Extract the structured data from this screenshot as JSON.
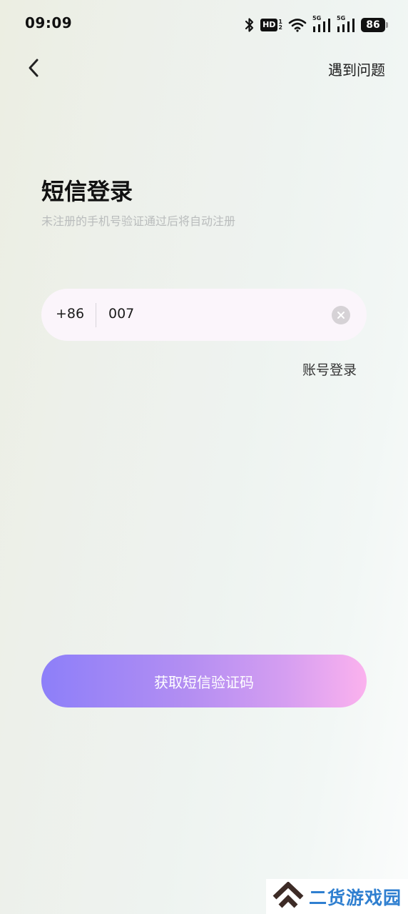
{
  "status_bar": {
    "time": "09:09",
    "hd_label": "HD",
    "network_label_1": "5G",
    "network_label_2": "5G",
    "battery_level": "86"
  },
  "header": {
    "help_label": "遇到问题"
  },
  "main": {
    "title": "短信登录",
    "subtitle": "未注册的手机号验证通过后将自动注册",
    "country_code": "+86",
    "phone_value": "007",
    "account_login_label": "账号登录",
    "submit_label": "获取短信验证码"
  },
  "watermark": {
    "text": "二货游戏园"
  },
  "colors": {
    "button_gradient_start": "#8d7ff9",
    "button_gradient_end": "#fbb2ee",
    "field_background": "#fbf5fb",
    "watermark_text": "#2f7fd0",
    "watermark_logo": "#3d2b26"
  },
  "icons": {
    "back": "chevron-left-icon",
    "clear": "close-circle-icon",
    "bluetooth": "bluetooth-icon",
    "wifi": "wifi-icon",
    "signal": "cellular-signal-icon",
    "battery": "battery-icon",
    "watermark_logo": "double-chevron-up-logo"
  }
}
